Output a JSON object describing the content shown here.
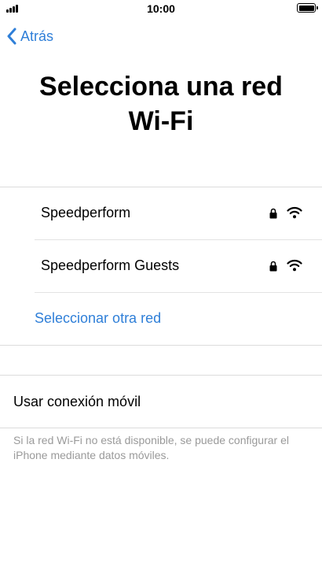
{
  "status_bar": {
    "time": "10:00"
  },
  "nav": {
    "back_label": "Atrás"
  },
  "title": "Selecciona una red Wi-Fi",
  "networks": [
    {
      "name": "Speedperform",
      "secured": true,
      "icon": "wifi-icon"
    },
    {
      "name": "Speedperform Guests",
      "secured": true,
      "icon": "wifi-icon"
    }
  ],
  "other_network_label": "Seleccionar otra red",
  "cellular": {
    "label": "Usar conexión móvil",
    "footnote": "Si la red Wi-Fi no está disponible, se puede configurar el iPhone mediante datos móviles."
  },
  "colors": {
    "accent": "#2f7fd8",
    "separator": "#dcdcdc",
    "footnote": "#9a9a9a"
  }
}
